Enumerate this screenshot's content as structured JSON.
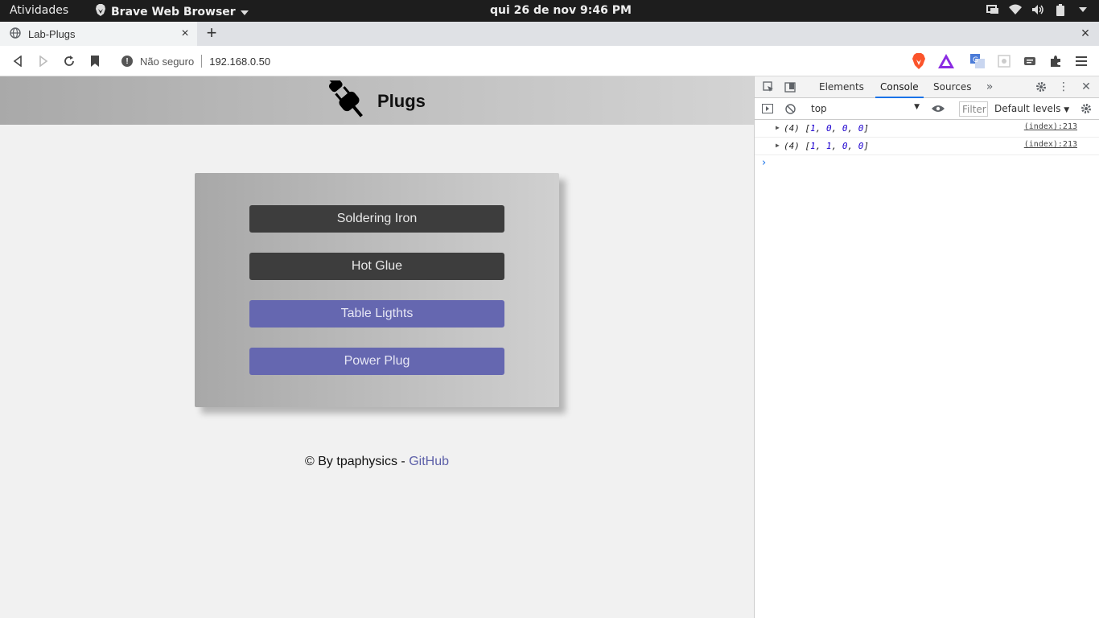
{
  "os": {
    "activities": "Atividades",
    "app_name": "Brave Web Browser",
    "clock": "qui 26 de nov   9:46 PM"
  },
  "browser": {
    "tab_title": "Lab-Plugs",
    "security_label": "Não seguro",
    "url": "192.168.0.50"
  },
  "page": {
    "header_title": "Plugs",
    "plugs": [
      {
        "label": "Soldering Iron",
        "state": 1
      },
      {
        "label": "Hot Glue",
        "state": 1
      },
      {
        "label": "Table Ligthts",
        "state": 0
      },
      {
        "label": "Power Plug",
        "state": 0
      }
    ],
    "footer_text": "© By tpaphysics - ",
    "footer_link": "GitHub",
    "colors": {
      "on": "#3d3d3d",
      "off": "#6567b0"
    }
  },
  "devtools": {
    "tabs": [
      "Elements",
      "Console",
      "Sources"
    ],
    "active_tab": "Console",
    "context": "top",
    "filter_placeholder": "Filter",
    "levels": "Default levels",
    "logs": [
      {
        "count": "(4)",
        "values": [
          1,
          0,
          0,
          0
        ],
        "source": "(index):213"
      },
      {
        "count": "(4)",
        "values": [
          1,
          1,
          0,
          0
        ],
        "source": "(index):213"
      }
    ]
  }
}
